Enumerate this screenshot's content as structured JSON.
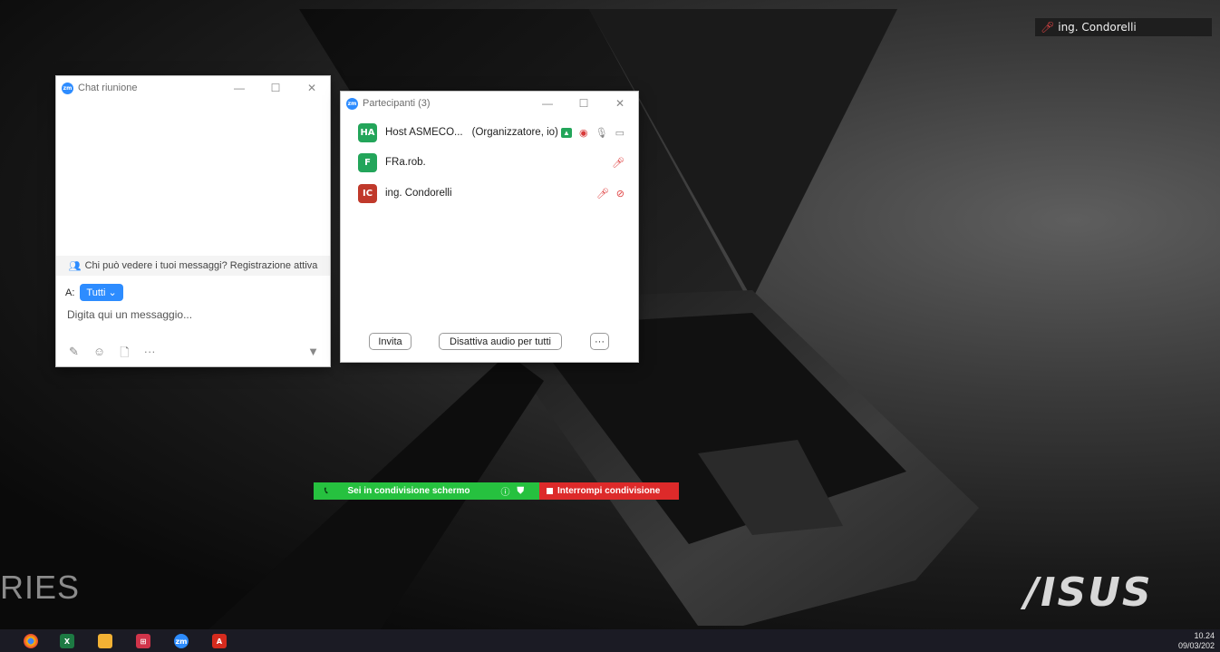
{
  "top_label": {
    "name": "ing. Condorelli",
    "icon": "mic-muted-icon"
  },
  "wallpaper": {
    "series_text": "RIES",
    "brand_text": "/ISUS"
  },
  "chat": {
    "title": "Chat riunione",
    "info": "Chi può vedere i tuoi messaggi? Registrazione attiva",
    "to_label": "A:",
    "to_value": "Tutti",
    "placeholder": "Digita qui un messaggio...",
    "more": "···"
  },
  "participants": {
    "title": "Partecipanti (3)",
    "list": [
      {
        "initials": "HA",
        "name": "Host ASMECO...",
        "role": "(Organizzatore, io)",
        "color": "#23a55a"
      },
      {
        "initials": "F",
        "name": "FRa.rob.",
        "role": "",
        "color": "#23a55a"
      },
      {
        "initials": "IC",
        "name": "ing. Condorelli",
        "role": "",
        "color": "#c0392b"
      }
    ],
    "invite": "Invita",
    "mute_all": "Disattiva audio per tutti",
    "more": "···"
  },
  "share_bar": {
    "status": "Sei in condivisione schermo",
    "stop": "Interrompi condivisione",
    "green": "#26c13f",
    "red": "#dd2a2a"
  },
  "taskbar": {
    "apps": [
      "chrome-icon",
      "excel-icon",
      "file-explorer-icon",
      "app-icon",
      "zoom-icon",
      "acrobat-icon"
    ],
    "time": "10.24",
    "date": "09/03/202"
  }
}
